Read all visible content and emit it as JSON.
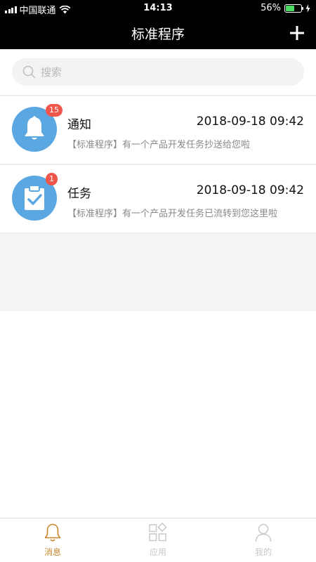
{
  "status_bar": {
    "carrier": "中国联通",
    "time": "14:13",
    "battery_percent": "56%",
    "battery_level": 0.56,
    "signal_icon": "signal-bars-icon",
    "wifi_icon": "wifi-icon",
    "charging_icon": "bolt-icon"
  },
  "header": {
    "title": "标准程序",
    "add_icon": "plus-icon"
  },
  "search": {
    "placeholder": "搜索",
    "icon": "search-icon"
  },
  "messages": [
    {
      "title": "通知",
      "time": "2018-09-18 09:42",
      "description": "【标准程序】有一个产品开发任务抄送给您啦",
      "badge": "15",
      "icon": "bell-icon"
    },
    {
      "title": "任务",
      "time": "2018-09-18 09:42",
      "description": "【标准程序】有一个产品开发任务已流转到您这里啦",
      "badge": "1",
      "icon": "clipboard-check-icon"
    }
  ],
  "tabbar": {
    "items": [
      {
        "label": "消息",
        "icon": "bell-outline-icon",
        "active": true
      },
      {
        "label": "应用",
        "icon": "apps-grid-icon",
        "active": false
      },
      {
        "label": "我的",
        "icon": "user-icon",
        "active": false
      }
    ]
  },
  "colors": {
    "accent_active": "#c9862c",
    "inactive": "#c8c8c8",
    "avatar_blue": "#5aa7e2",
    "badge_red": "#f1564a",
    "header_bg": "#000000"
  }
}
